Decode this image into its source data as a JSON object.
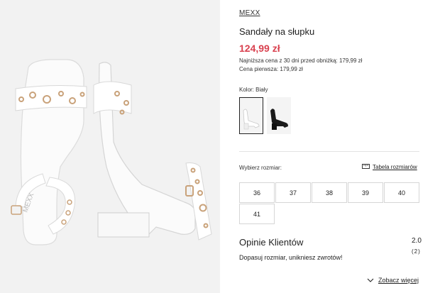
{
  "product": {
    "brand": "MEXX",
    "title": "Sandały na słupku",
    "price": "124,99 zł",
    "lowest_price_note": "Najniższa cena z 30 dni przed obniżką: 179,99 zł",
    "original_price_note": "Cena pierwsza: 179,99 zł",
    "image_logo_text": "MEXX"
  },
  "color": {
    "label": "Kolor: Biały",
    "options": [
      {
        "name": "white",
        "selected": true
      },
      {
        "name": "black",
        "selected": false
      }
    ]
  },
  "size": {
    "label": "Wybierz rozmiar:",
    "chart_link": "Tabela rozmiarów",
    "options": [
      "36",
      "37",
      "38",
      "39",
      "40",
      "41"
    ]
  },
  "reviews": {
    "title": "Opinie Klientów",
    "rating": "2.0",
    "count": "(2)",
    "text": "Dopasuj rozmiar, unikniesz zwrotów!",
    "more_link": "Zobacz więcej"
  },
  "colors": {
    "price": "#d9414f",
    "gallery_bg": "#f2f2f2",
    "selected_border": "#222222"
  }
}
